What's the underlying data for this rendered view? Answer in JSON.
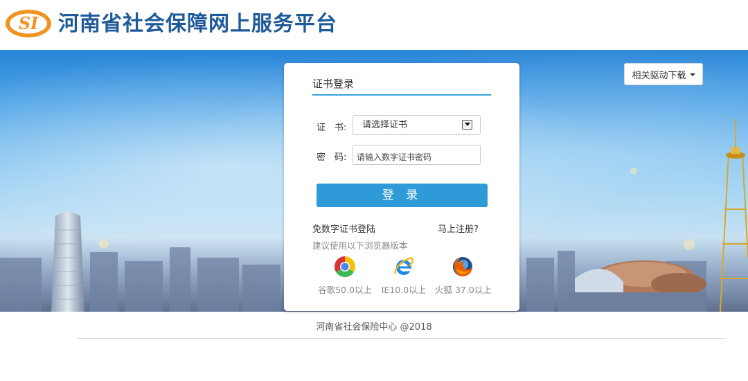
{
  "header": {
    "logo_text": "SI",
    "title": "河南省社会保障网上服务平台"
  },
  "toolbar": {
    "driver_download_label": "相关驱动下载"
  },
  "login": {
    "tab_title": "证书登录",
    "cert_label": "证　书:",
    "cert_selected": "请选择证书",
    "password_label": "密　码:",
    "password_placeholder": "请输入数字证书密码",
    "submit_label": "登 录",
    "free_login_link": "免数字证书登陆",
    "register_link": "马上注册?",
    "browser_hint": "建议使用以下浏览器版本",
    "browsers": [
      {
        "label": "谷歌50.0以上",
        "icon": "chrome-icon"
      },
      {
        "label": "IE10.0以上",
        "icon": "ie-icon"
      },
      {
        "label": "火狐 37.0以上",
        "icon": "firefox-icon"
      }
    ]
  },
  "footer": {
    "copyright": "河南省社会保险中心 @2018"
  },
  "colors": {
    "brand_blue": "#1e5a9a",
    "logo_orange": "#f2921f",
    "accent": "#2e9bd8"
  }
}
